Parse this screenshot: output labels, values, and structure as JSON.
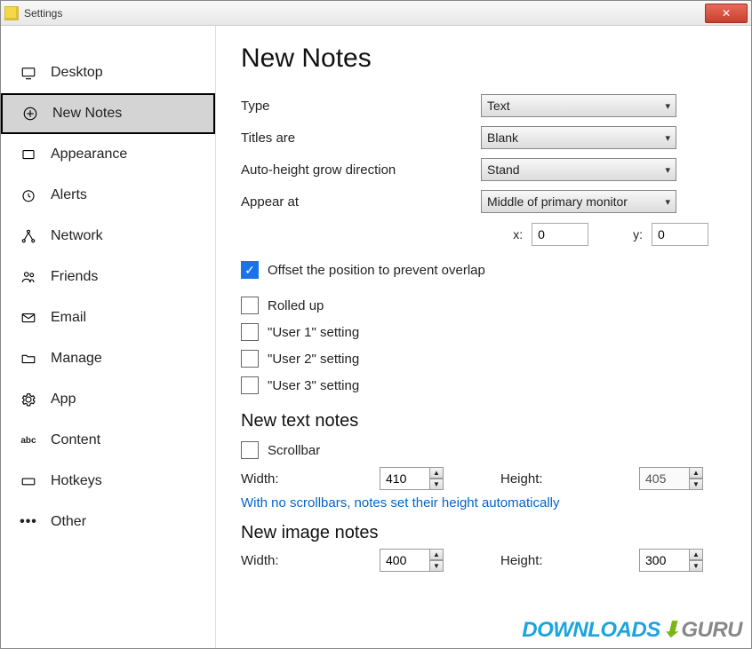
{
  "window": {
    "title": "Settings"
  },
  "sidebar": {
    "items": [
      {
        "label": "Desktop"
      },
      {
        "label": "New Notes"
      },
      {
        "label": "Appearance"
      },
      {
        "label": "Alerts"
      },
      {
        "label": "Network"
      },
      {
        "label": "Friends"
      },
      {
        "label": "Email"
      },
      {
        "label": "Manage"
      },
      {
        "label": "App"
      },
      {
        "label": "Content"
      },
      {
        "label": "Hotkeys"
      },
      {
        "label": "Other"
      }
    ],
    "selected_index": 1
  },
  "page": {
    "heading": "New Notes",
    "type_label": "Type",
    "type_value": "Text",
    "titles_label": "Titles are",
    "titles_value": "Blank",
    "grow_label": "Auto-height grow direction",
    "grow_value": "Stand",
    "appear_label": "Appear at",
    "appear_value": "Middle of primary monitor",
    "x_label": "x:",
    "x_value": "0",
    "y_label": "y:",
    "y_value": "0",
    "offset_label": "Offset the position to prevent overlap",
    "rolled_label": "Rolled up",
    "user1_label": "\"User 1\" setting",
    "user2_label": "\"User 2\" setting",
    "user3_label": "\"User 3\" setting",
    "text_section": "New text notes",
    "scrollbar_label": "Scrollbar",
    "width_label": "Width:",
    "height_label": "Height:",
    "text_width": "410",
    "text_height": "405",
    "hint": "With no scrollbars, notes set their height automatically",
    "image_section": "New image notes",
    "image_width": "400",
    "image_height": "300"
  },
  "watermark": {
    "part1": "DOWNLOADS",
    "part2": "GURU"
  }
}
